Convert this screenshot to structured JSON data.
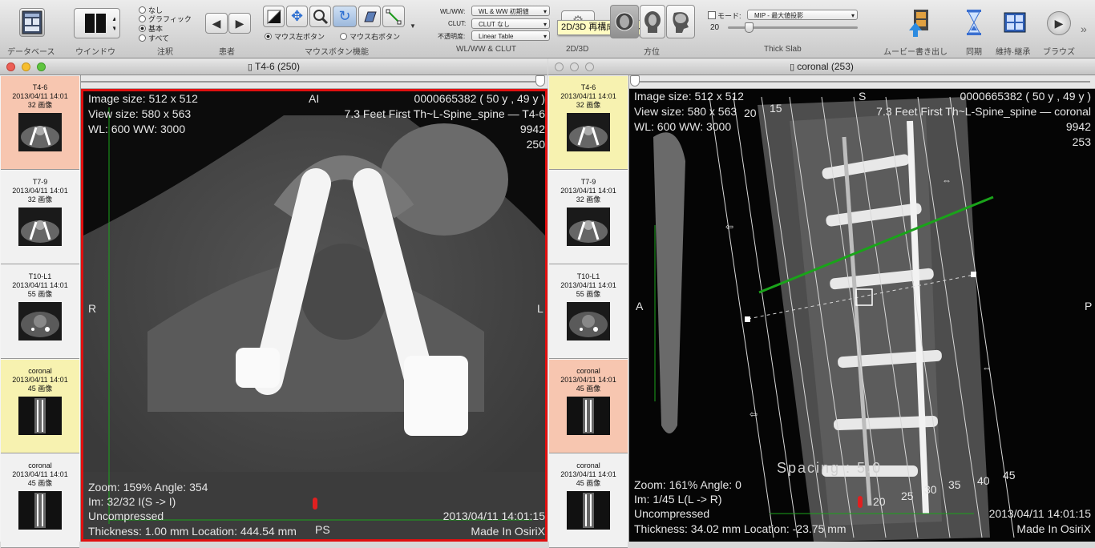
{
  "toolbar": {
    "groups": {
      "database": "データベース",
      "window": "ウインドウ",
      "annotation": "注釈",
      "patient": "患者",
      "mouse": "マウスボタン機能",
      "wlww": "WL/WW & CLUT",
      "d2d3": "2D/3D",
      "orientation": "方位",
      "thickslab": "Thick Slab",
      "movie": "ムービー書き出し",
      "sync": "同期",
      "keep": "維持·継承",
      "browse": "ブラウズ"
    },
    "annotation_options": [
      "なし",
      "グラフィック",
      "基本",
      "すべて"
    ],
    "annotation_selected": "基本",
    "mouse_left": "マウス左ボタン",
    "mouse_right": "マウス右ボタン",
    "wlww_label": "WL/WW:",
    "wlww_value": "WL & WW 初期値",
    "clut_label": "CLUT:",
    "clut_value": "CLUT なし",
    "opacity_label": "不透明度:",
    "opacity_value": "Linear Table",
    "tooltip": "2D/3D 再構成ツール",
    "mode_label": "モード:",
    "mode_value": "MIP - 最大値投影",
    "slab_value": "20"
  },
  "left_window": {
    "title": "T4-6 (250)"
  },
  "right_window": {
    "title": "coronal (253)"
  },
  "series_left": [
    {
      "name": "T4-6",
      "date": "2013/04/11 14:01",
      "count": "32 画像"
    },
    {
      "name": "T7-9",
      "date": "2013/04/11 14:01",
      "count": "32 画像"
    },
    {
      "name": "T10-L1",
      "date": "2013/04/11 14:01",
      "count": "55 画像"
    },
    {
      "name": "coronal",
      "date": "2013/04/11 14:01",
      "count": "45 画像"
    },
    {
      "name": "coronal",
      "date": "2013/04/11 14:01",
      "count": "45 画像"
    }
  ],
  "series_right": [
    {
      "name": "T4-6",
      "date": "2013/04/11 14:01",
      "count": "32 画像"
    },
    {
      "name": "T7-9",
      "date": "2013/04/11 14:01",
      "count": "32 画像"
    },
    {
      "name": "T10-L1",
      "date": "2013/04/11 14:01",
      "count": "55 画像"
    },
    {
      "name": "coronal",
      "date": "2013/04/11 14:01",
      "count": "45 画像"
    },
    {
      "name": "coronal",
      "date": "2013/04/11 14:01",
      "count": "45 画像"
    }
  ],
  "viewer_left": {
    "image_size": "Image size: 512 x 512",
    "view_size": "View size: 580 x 563",
    "wl": "WL: 600 WW: 3000",
    "orient_top": "AI",
    "orient_left": "R",
    "orient_right": "L",
    "orient_bottom": "PS",
    "patient_id": "0000665382 ( 50 y , 49 y )",
    "study": "7.3 Feet First Th~L-Spine_spine — T4-6",
    "num1": "9942",
    "num2": "250",
    "zoom": "Zoom: 159% Angle: 354",
    "im": "Im: 32/32 I(S -> I)",
    "compression": "Uncompressed",
    "thickness": "Thickness: 1.00 mm Location: 444.54 mm",
    "date": "2013/04/11 14:01:15",
    "made": "Made In OsiriX"
  },
  "viewer_right": {
    "image_size": "Image size: 512 x 512",
    "view_size": "View size: 580 x 563",
    "wl": "WL: 600 WW: 3000",
    "orient_top": "S",
    "orient_left": "A",
    "orient_right": "P",
    "patient_id": "0000665382 ( 50 y , 49 y )",
    "study": "7.3 Feet First Th~L-Spine_spine — coronal",
    "num1": "9942",
    "num2": "253",
    "zoom": "Zoom: 161% Angle: 0",
    "im": "Im: 1/45 L(L -> R)",
    "compression": "Uncompressed",
    "thickness": "Thickness: 34.02 mm Location: -23.75 mm",
    "date": "2013/04/11 14:01:15",
    "made": "Made In OsiriX",
    "spacing": "Spacing : 5.0",
    "slab_marks": [
      "15",
      "20",
      "25",
      "30",
      "35",
      "40",
      "45"
    ],
    "top_marks": [
      "15",
      "20"
    ]
  }
}
